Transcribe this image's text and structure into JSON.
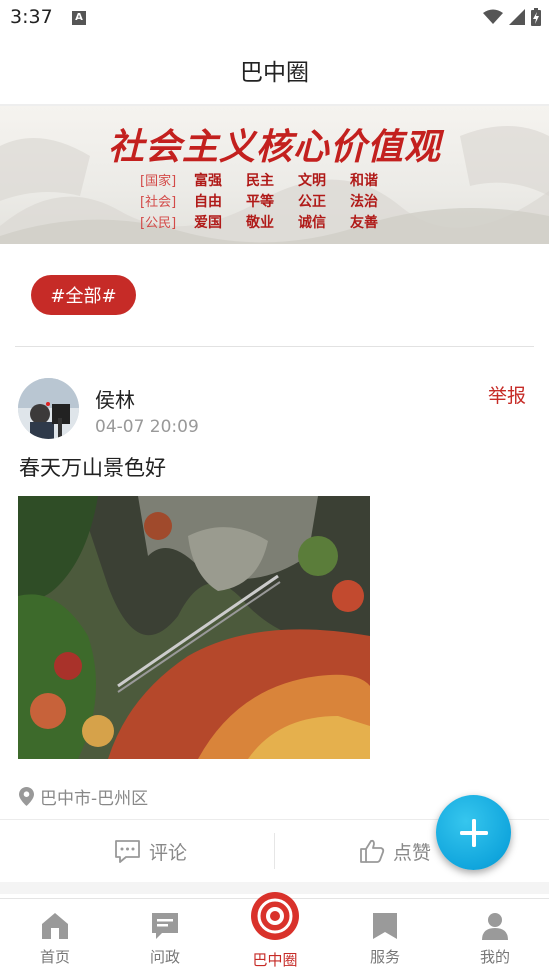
{
  "status_bar": {
    "time": "3:37",
    "notification_letter": "A"
  },
  "header": {
    "title": "巴中圈"
  },
  "banner": {
    "slogan": "社会主义核心价值观",
    "rows": [
      {
        "tag": "[国家]",
        "words": [
          "富强",
          "民主",
          "文明",
          "和谐"
        ]
      },
      {
        "tag": "[社会]",
        "words": [
          "自由",
          "平等",
          "公正",
          "法治"
        ]
      },
      {
        "tag": "[公民]",
        "words": [
          "爱国",
          "敬业",
          "诚信",
          "友善"
        ]
      }
    ]
  },
  "filter": {
    "chip_label": "#全部#"
  },
  "post": {
    "username": "侯林",
    "time": "04-07 20:09",
    "report_label": "举报",
    "text": "春天万山景色好",
    "location": "巴中市-巴州区",
    "comment_label": "评论",
    "like_label": "点赞"
  },
  "tabs": [
    {
      "label": "首页",
      "icon": "home-icon",
      "active": false
    },
    {
      "label": "问政",
      "icon": "message-icon",
      "active": false
    },
    {
      "label": "巴中圈",
      "icon": "circle-icon",
      "active": true
    },
    {
      "label": "服务",
      "icon": "bookmark-icon",
      "active": false
    },
    {
      "label": "我的",
      "icon": "profile-icon",
      "active": false
    }
  ],
  "colors": {
    "accent": "#c62b27",
    "fab": "#11a6dd",
    "tab_inactive": "#777777"
  }
}
